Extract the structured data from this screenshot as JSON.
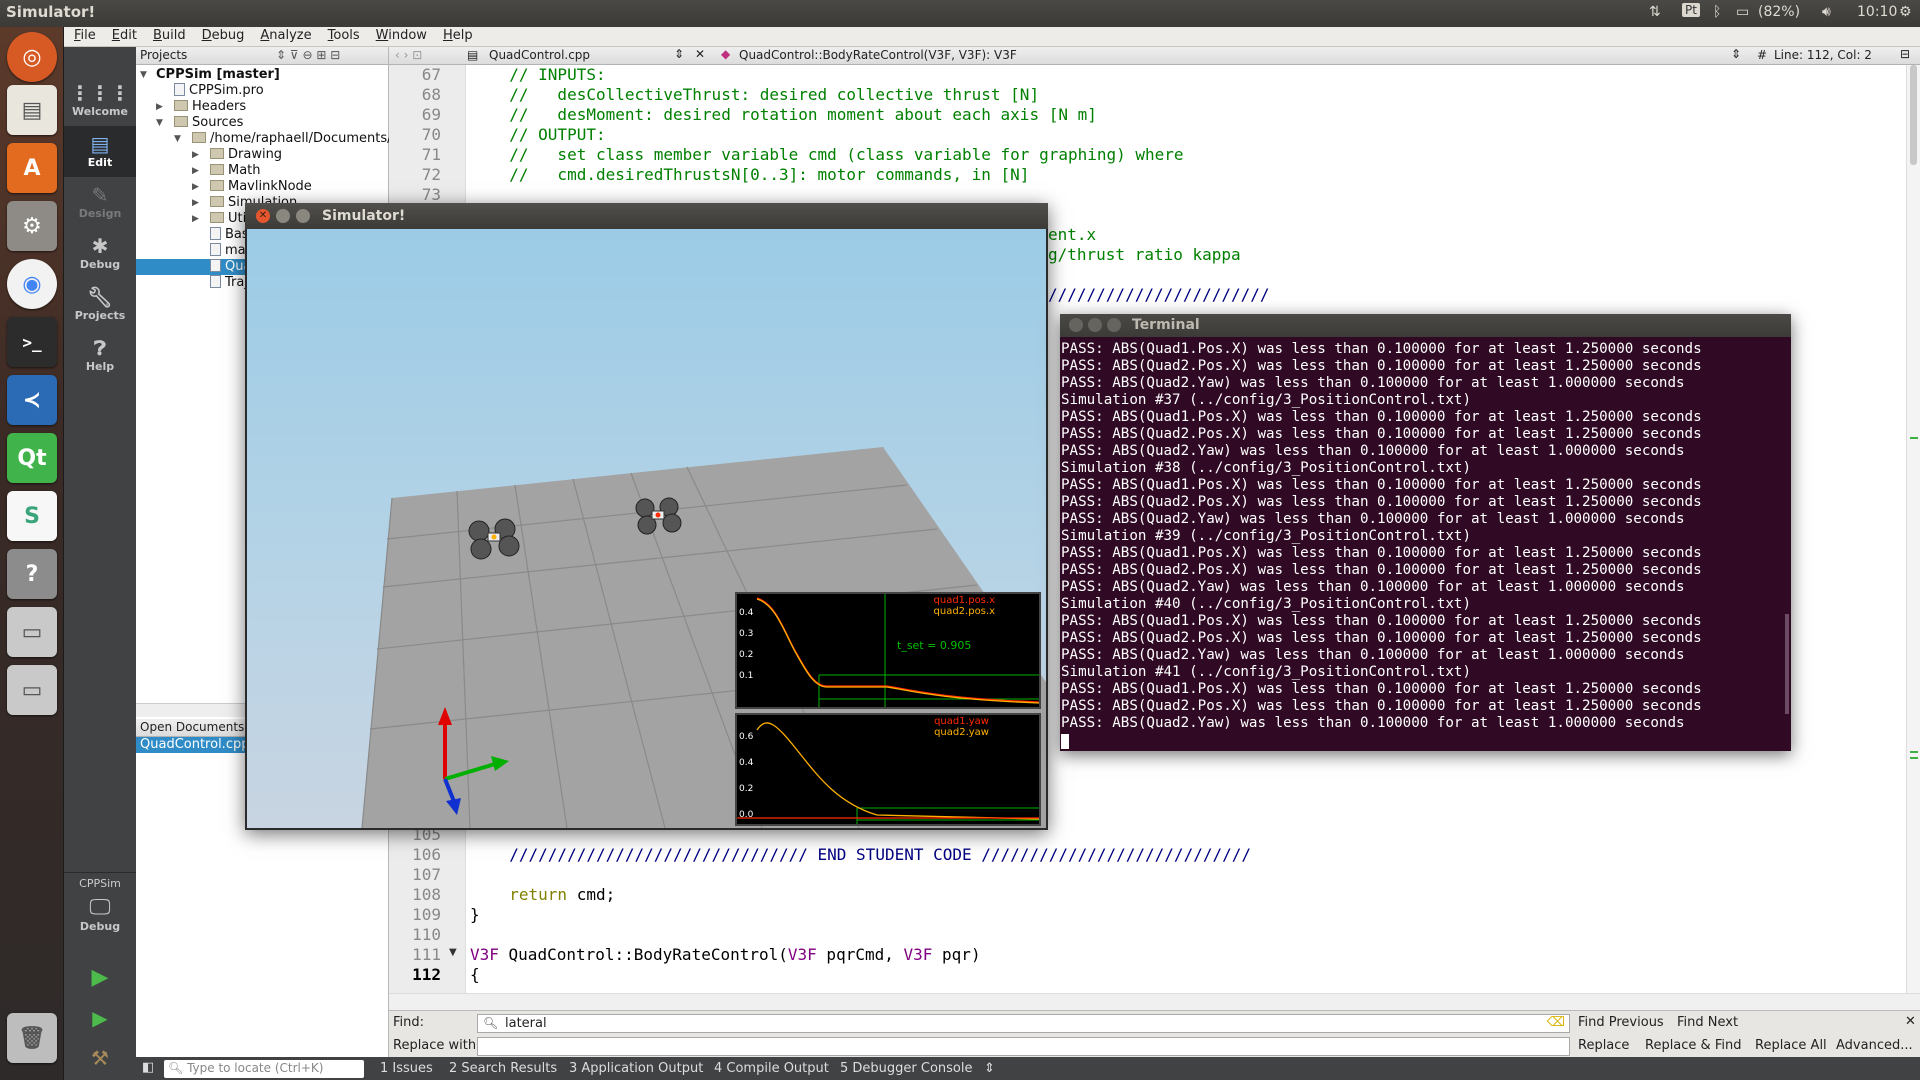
{
  "top_panel": {
    "app_title": "Simulator!",
    "keyboard_indicator": "Pt",
    "battery": "(82%)",
    "clock": "10:10"
  },
  "launcher": {
    "items": [
      "dash-home-icon",
      "file-manager-icon",
      "software-center-icon",
      "system-settings-icon",
      "chrome-icon",
      "terminal-icon",
      "vscode-icon",
      "qt-creator-icon",
      "slack-icon",
      "help-icon",
      "drive-icon",
      "drive-icon",
      "trash-icon"
    ],
    "qt_label": "Qt",
    "slack_label": "S",
    "help_label": "?",
    "terminal_label": ">_"
  },
  "menubar": {
    "items": [
      "File",
      "Edit",
      "Build",
      "Debug",
      "Analyze",
      "Tools",
      "Window",
      "Help"
    ]
  },
  "modes": {
    "items": [
      {
        "label": "Welcome",
        "icon": "welcome-grid-icon"
      },
      {
        "label": "Edit",
        "icon": "edit-icon"
      },
      {
        "label": "Design",
        "icon": "design-icon"
      },
      {
        "label": "Debug",
        "icon": "debug-bug-icon"
      },
      {
        "label": "Projects",
        "icon": "projects-wrench-icon"
      },
      {
        "label": "Help",
        "icon": "help-icon"
      }
    ],
    "target_project": "CPPSim",
    "target_mode": "Debug"
  },
  "projects": {
    "header": "Projects",
    "tree": [
      {
        "label": "CPPSim [master]"
      },
      {
        "label": "CPPSim.pro"
      },
      {
        "label": "Headers"
      },
      {
        "label": "Sources"
      },
      {
        "label": "/home/raphaell/Documents/u"
      },
      {
        "label": "Drawing"
      },
      {
        "label": "Math"
      },
      {
        "label": "MavlinkNode"
      },
      {
        "label": "Simulation"
      },
      {
        "label": "Utility"
      },
      {
        "label": "BaseController.cpp"
      },
      {
        "label": "main.cpp"
      },
      {
        "label": "QuadControl.cpp"
      },
      {
        "label": "Trajectory.cpp"
      }
    ],
    "open_documents_header": "Open Documents",
    "open_documents": [
      "QuadControl.cpp"
    ]
  },
  "editor": {
    "file_tab": "QuadControl.cpp",
    "symbol": "QuadControl::BodyRateControl(V3F, V3F): V3F",
    "hash": "#",
    "cursor_pos": "Line: 112, Col: 2",
    "line_numbers": [
      "67",
      "68",
      "69",
      "70",
      "71",
      "72",
      "73",
      "105",
      "106",
      "107",
      "108",
      "109",
      "110",
      "111",
      "112"
    ],
    "lines_top": [
      "  // INPUTS:",
      "  //   desCollectiveThrust: desired collective thrust [N]",
      "  //   desMoment: desired rotation moment about each axis [N m]",
      "  // OUTPUT:",
      "  //   set class member variable cmd (class variable for graphing) where",
      "  //   cmd.desiredThrustsN[0..3]: motor commands, in [N]"
    ],
    "visible_fragments": [
      "ent.x",
      "g/thrust ratio kappa",
      "///////////////////////"
    ],
    "end_student_code": "  /////////////////////////////// END STUDENT CODE ////////////////////////////",
    "return_kw": "return",
    "return_rest": " cmd;",
    "close_brace": "}",
    "func_sig": {
      "t1": "V3F",
      "name": " QuadControl::BodyRateControl(",
      "t2": "V3F",
      "p1": " pqrCmd, ",
      "t3": "V3F",
      "p2": " pqr)"
    },
    "open_brace": "{"
  },
  "find": {
    "find_label": "Find:",
    "find_value": "lateral",
    "replace_label": "Replace with:",
    "find_previous": "Find Previous",
    "find_next": "Find Next",
    "replace": "Replace",
    "replace_find": "Replace & Find",
    "replace_all": "Replace All",
    "advanced": "Advanced..."
  },
  "bottom": {
    "locate_placeholder": "Type to locate (Ctrl+K)",
    "tabs": [
      "1  Issues",
      "2  Search Results",
      "3  Application Output",
      "4  Compile Output",
      "5  Debugger Console"
    ]
  },
  "simulator": {
    "title": "Simulator!",
    "plot1": {
      "legend": [
        "quad1.pos.x",
        "quad2.pos.x"
      ],
      "yticks": [
        "0.4",
        "0.3",
        "0.2",
        "0.1"
      ],
      "annotation": "t_set  =  0.905"
    },
    "plot2": {
      "legend": [
        "quad1.yaw",
        "quad2.yaw"
      ],
      "yticks": [
        "0.6",
        "0.4",
        "0.2",
        "0.0"
      ]
    },
    "colors": {
      "quad1": "#ff2a00",
      "quad2": "#ffb000",
      "threshold": "#00c000"
    }
  },
  "terminal": {
    "title": "Terminal",
    "lines": [
      "PASS: ABS(Quad1.Pos.X) was less than 0.100000 for at least 1.250000 seconds",
      "PASS: ABS(Quad2.Pos.X) was less than 0.100000 for at least 1.250000 seconds",
      "PASS: ABS(Quad2.Yaw) was less than 0.100000 for at least 1.000000 seconds",
      "Simulation #37 (../config/3_PositionControl.txt)",
      "PASS: ABS(Quad1.Pos.X) was less than 0.100000 for at least 1.250000 seconds",
      "PASS: ABS(Quad2.Pos.X) was less than 0.100000 for at least 1.250000 seconds",
      "PASS: ABS(Quad2.Yaw) was less than 0.100000 for at least 1.000000 seconds",
      "Simulation #38 (../config/3_PositionControl.txt)",
      "PASS: ABS(Quad1.Pos.X) was less than 0.100000 for at least 1.250000 seconds",
      "PASS: ABS(Quad2.Pos.X) was less than 0.100000 for at least 1.250000 seconds",
      "PASS: ABS(Quad2.Yaw) was less than 0.100000 for at least 1.000000 seconds",
      "Simulation #39 (../config/3_PositionControl.txt)",
      "PASS: ABS(Quad1.Pos.X) was less than 0.100000 for at least 1.250000 seconds",
      "PASS: ABS(Quad2.Pos.X) was less than 0.100000 for at least 1.250000 seconds",
      "PASS: ABS(Quad2.Yaw) was less than 0.100000 for at least 1.000000 seconds",
      "Simulation #40 (../config/3_PositionControl.txt)",
      "PASS: ABS(Quad1.Pos.X) was less than 0.100000 for at least 1.250000 seconds",
      "PASS: ABS(Quad2.Pos.X) was less than 0.100000 for at least 1.250000 seconds",
      "PASS: ABS(Quad2.Yaw) was less than 0.100000 for at least 1.000000 seconds",
      "Simulation #41 (../config/3_PositionControl.txt)",
      "PASS: ABS(Quad1.Pos.X) was less than 0.100000 for at least 1.250000 seconds",
      "PASS: ABS(Quad2.Pos.X) was less than 0.100000 for at least 1.250000 seconds",
      "PASS: ABS(Quad2.Yaw) was less than 0.100000 for at least 1.000000 seconds"
    ]
  }
}
